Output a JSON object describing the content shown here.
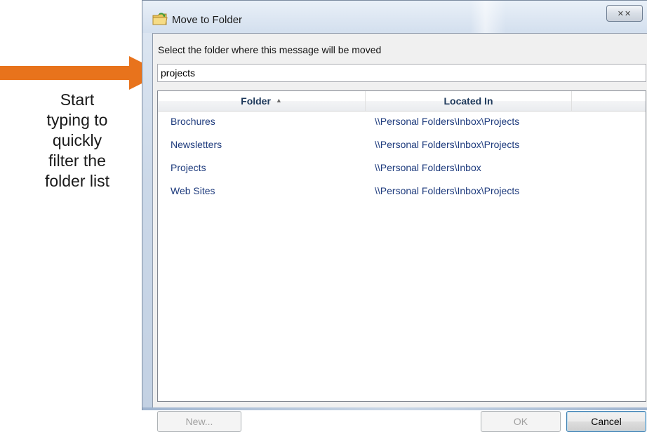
{
  "annotation": {
    "lines": [
      "Start",
      "typing to",
      "quickly",
      "filter the",
      "folder list"
    ],
    "arrow_color": "#e8731c"
  },
  "dialog": {
    "title": "Move to Folder",
    "close_glyph": "☒",
    "prompt": "Select the folder where this message will be moved",
    "filter_value": "projects",
    "columns": {
      "folder": "Folder",
      "located_in": "Located In",
      "sort_indicator": "▲"
    },
    "rows": [
      {
        "folder": "Brochures",
        "located_in": "\\\\Personal Folders\\Inbox\\Projects"
      },
      {
        "folder": "Newsletters",
        "located_in": "\\\\Personal Folders\\Inbox\\Projects"
      },
      {
        "folder": "Projects",
        "located_in": "\\\\Personal Folders\\Inbox"
      },
      {
        "folder": "Web Sites",
        "located_in": "\\\\Personal Folders\\Inbox\\Projects"
      }
    ],
    "buttons": {
      "new": "New...",
      "ok": "OK",
      "cancel": "Cancel"
    }
  },
  "icons": {
    "title_icon": "folder-arrow-icon",
    "close_icon": "close-icon",
    "sort_icon": "sort-ascending-icon"
  }
}
